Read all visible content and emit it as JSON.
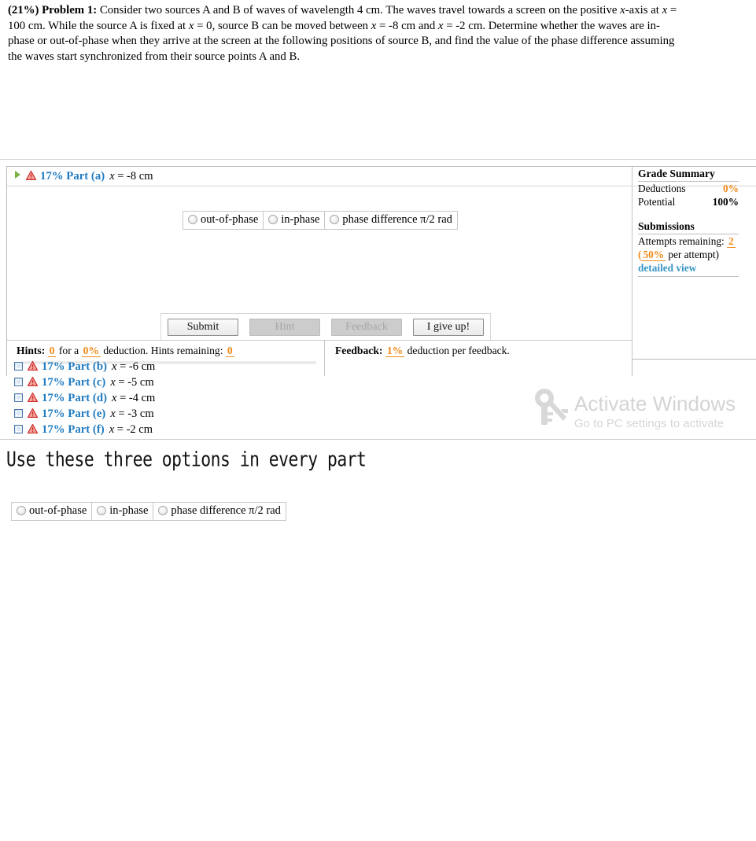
{
  "problem": {
    "percent_label": "(21%) Problem 1:",
    "text_part_1": " Consider two sources A and B of waves of wavelength 4 cm. The waves travel towards a screen on the positive ",
    "x1": "x",
    "text_part_2": "-axis at ",
    "x2": "x",
    "text_part_3": " = 100 cm. While the source A is fixed at ",
    "x3": "x",
    "text_part_4": " = 0, source B can be moved between ",
    "x4": "x",
    "text_part_5": " = -8 cm and ",
    "x5": "x",
    "text_part_6": " = -2 cm. Determine whether the waves are in-phase or out-of-phase when they arrive at the screen at the following positions of source B, and find the value of the phase difference assuming the waves start synchronized from their source points A and B."
  },
  "part_a": {
    "percent": "17% Part (a)",
    "x_label": "x",
    "x_value": " = -8 cm",
    "expand_icon": "play-triangle-icon",
    "warning_icon": "warning-triangle-icon"
  },
  "answer_options": [
    {
      "label": "out-of-phase",
      "selected": false
    },
    {
      "label": "in-phase",
      "selected": false
    },
    {
      "label": "phase difference π/2 rad",
      "selected": false
    }
  ],
  "buttons": [
    {
      "label": "Submit",
      "disabled": false
    },
    {
      "label": "Hint",
      "disabled": true
    },
    {
      "label": "Feedback",
      "disabled": true
    },
    {
      "label": "I give up!",
      "disabled": false
    }
  ],
  "hints": {
    "label": "Hints:",
    "count": "0",
    "for_a": " for a ",
    "deduction_pct": "0%",
    "deduction_text": " deduction. Hints remaining: ",
    "remaining": "0"
  },
  "feedback": {
    "label": "Feedback:",
    "deduction_pct": "1%",
    "text": " deduction per feedback."
  },
  "grade_summary": {
    "title": "Grade Summary",
    "rows": [
      {
        "label": "Deductions",
        "value": "0%",
        "orange": true
      },
      {
        "label": "Potential",
        "value": "100%",
        "orange": false
      }
    ],
    "submissions_title": "Submissions",
    "attempts_label": "Attempts remaining: ",
    "attempts_value": "2",
    "per_attempt_open": "(",
    "per_attempt_pct": "50%",
    "per_attempt_text": " per attempt)",
    "detailed_view": "detailed view"
  },
  "parts": [
    {
      "percent": "17% Part (b)",
      "x_label": "x",
      "x_value": " = -6 cm"
    },
    {
      "percent": "17% Part (c)",
      "x_label": "x",
      "x_value": " = -5 cm"
    },
    {
      "percent": "17% Part (d)",
      "x_label": "x",
      "x_value": " = -4 cm"
    },
    {
      "percent": "17% Part (e)",
      "x_label": "x",
      "x_value": " = -3 cm"
    },
    {
      "percent": "17% Part (f)",
      "x_label": "x",
      "x_value": " = -2 cm"
    }
  ],
  "annotation": {
    "text": "Use these three options in every part"
  },
  "watermark": {
    "title": "Activate Windows",
    "subtitle": "Go to PC settings to activate \u0001",
    "icon": "key-icon"
  },
  "colors": {
    "part_blue": "#1f7bc1",
    "orange": "#ef8a17",
    "link_blue": "#3a96c4",
    "warning_red": "#cf2a24",
    "green_arrow": "#7cb342",
    "watermark_gray": "#d4d4d4"
  }
}
